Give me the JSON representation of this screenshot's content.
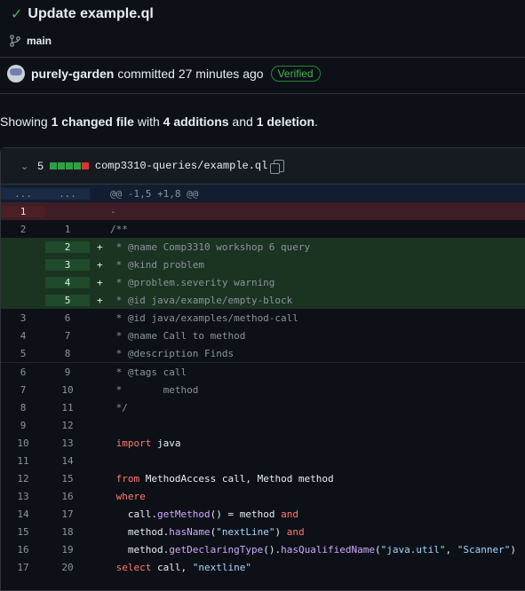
{
  "commit": {
    "title": "Update example.ql",
    "branch": "main",
    "author": "purely-garden",
    "meta": "committed 27 minutes ago",
    "badge": "Verified"
  },
  "summary": {
    "prefix": "Showing ",
    "files": "1 changed file",
    "with": " with ",
    "additions": "4 additions",
    "and": " and ",
    "deletions": "1 deletion",
    "end": "."
  },
  "file": {
    "change_count": "5",
    "name": "comp3310-queries/example.ql",
    "colors": {
      "add": "#2ea043",
      "del": "#da3633"
    }
  },
  "hunk": {
    "old": "...",
    "new": "...",
    "header": "@@ -1,5 +1,8 @@"
  },
  "lines": [
    {
      "type": "del",
      "old": "1",
      "new": "",
      "marker": "",
      "code": "-"
    },
    {
      "type": "ctx",
      "old": "2",
      "new": "1",
      "marker": "",
      "code": "/**"
    },
    {
      "type": "add",
      "old": "",
      "new": "2",
      "marker": "+",
      "code": " * @name Comp3310 workshop 6 query"
    },
    {
      "type": "add",
      "old": "",
      "new": "3",
      "marker": "+",
      "code": " * @kind problem"
    },
    {
      "type": "add",
      "old": "",
      "new": "4",
      "marker": "+",
      "code": " * @problem.severity warning"
    },
    {
      "type": "add",
      "old": "",
      "new": "5",
      "marker": "+",
      "code": " * @id java/example/empty-block"
    },
    {
      "type": "ctx",
      "old": "3",
      "new": "6",
      "marker": "",
      "code": " * @id java/examples/method-call"
    },
    {
      "type": "ctx",
      "old": "4",
      "new": "7",
      "marker": "",
      "code": " * @name Call to method"
    },
    {
      "type": "ctx",
      "old": "5",
      "new": "8",
      "marker": "",
      "code": " * @description Finds"
    },
    {
      "type": "ctx",
      "old": "6",
      "new": "9",
      "marker": "",
      "code": " * @tags call"
    },
    {
      "type": "ctx",
      "old": "7",
      "new": "10",
      "marker": "",
      "code": " *       method"
    },
    {
      "type": "ctx",
      "old": "8",
      "new": "11",
      "marker": "",
      "code": " */"
    },
    {
      "type": "ctx",
      "old": "9",
      "new": "12",
      "marker": "",
      "code": ""
    },
    {
      "type": "ctx",
      "old": "10",
      "new": "13",
      "marker": "",
      "code": " import java"
    },
    {
      "type": "ctx",
      "old": "11",
      "new": "14",
      "marker": "",
      "code": ""
    },
    {
      "type": "ctx",
      "old": "12",
      "new": "15",
      "marker": "",
      "code": " from MethodAccess call, Method method"
    },
    {
      "type": "ctx",
      "old": "13",
      "new": "16",
      "marker": "",
      "code": " where"
    },
    {
      "type": "ctx",
      "old": "14",
      "new": "17",
      "marker": "",
      "code": "   call.getMethod() = method and"
    },
    {
      "type": "ctx",
      "old": "15",
      "new": "18",
      "marker": "",
      "code": "   method.hasName(\"nextLine\") and"
    },
    {
      "type": "ctx",
      "old": "16",
      "new": "19",
      "marker": "",
      "code": "   method.getDeclaringType().hasQualifiedName(\"java.util\", \"Scanner\")"
    },
    {
      "type": "ctx",
      "old": "17",
      "new": "20",
      "marker": "",
      "code": " select call, \"nextline\""
    }
  ]
}
